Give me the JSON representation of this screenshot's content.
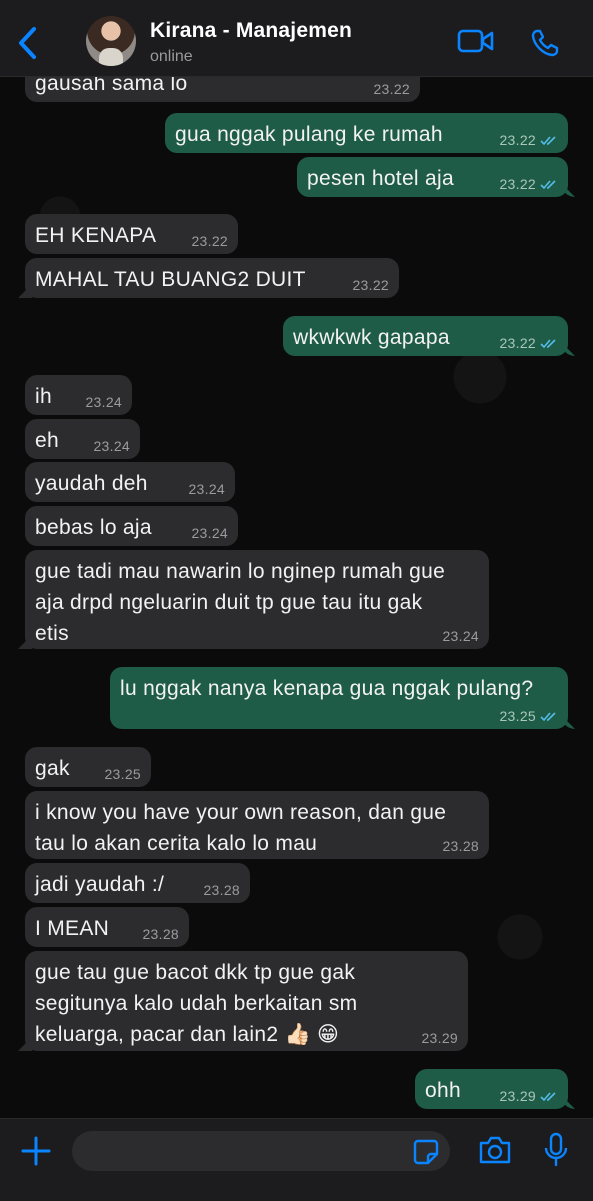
{
  "header": {
    "contact_name": "Kirana - Manajemen",
    "status": "online",
    "icons": [
      "back-chevron-icon",
      "video-call-icon",
      "phone-call-icon"
    ],
    "accent": "#0a84ff"
  },
  "messages": [
    {
      "dir": "in",
      "text": "gausah sama lo",
      "time": "23.22"
    },
    {
      "dir": "out",
      "text": "gua nggak pulang ke rumah",
      "time": "23.22"
    },
    {
      "dir": "out",
      "text": "pesen hotel aja",
      "time": "23.22"
    },
    {
      "dir": "in",
      "text": "EH KENAPA",
      "time": "23.22"
    },
    {
      "dir": "in",
      "text": "MAHAL TAU BUANG2 DUIT",
      "time": "23.22"
    },
    {
      "dir": "out",
      "text": "wkwkwk gapapa",
      "time": "23.22"
    },
    {
      "dir": "in",
      "text": "ih",
      "time": "23.24"
    },
    {
      "dir": "in",
      "text": "eh",
      "time": "23.24"
    },
    {
      "dir": "in",
      "text": "yaudah deh",
      "time": "23.24"
    },
    {
      "dir": "in",
      "text": "bebas lo aja",
      "time": "23.24"
    },
    {
      "dir": "in",
      "text": "gue tadi mau nawarin lo nginep rumah gue\naja drpd ngeluarin duit tp gue tau itu gak\netis",
      "time": "23.24"
    },
    {
      "dir": "out",
      "text": "lu nggak nanya kenapa gua nggak pulang?",
      "time": "23.25"
    },
    {
      "dir": "in",
      "text": "gak",
      "time": "23.25"
    },
    {
      "dir": "in",
      "text": "i know you have your own reason, dan gue\ntau lo akan cerita kalo lo mau",
      "time": "23.28"
    },
    {
      "dir": "in",
      "text": "jadi yaudah :/",
      "time": "23.28"
    },
    {
      "dir": "in",
      "text": "I MEAN",
      "time": "23.28"
    },
    {
      "dir": "in",
      "text": "gue tau gue bacot dkk tp gue gak\nsegitunya kalo udah berkaitan sm\nkeluarga, pacar dan lain2 👍🏻 😁",
      "time": "23.29"
    },
    {
      "dir": "out",
      "text": "ohh",
      "time": "23.29"
    }
  ],
  "colors": {
    "incoming_bubble": "#2c2c2e",
    "outgoing_bubble": "#1f5c47",
    "read_tick": "#53bdeb",
    "background": "#0b0b0b"
  },
  "input": {
    "placeholder": "",
    "icons": [
      "plus-icon",
      "sticker-icon",
      "camera-icon",
      "microphone-icon"
    ]
  }
}
